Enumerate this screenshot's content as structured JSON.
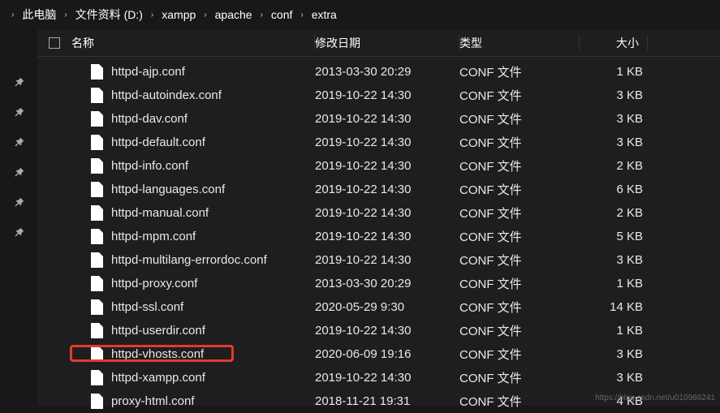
{
  "breadcrumb": [
    "此电脑",
    "文件资料 (D:)",
    "xampp",
    "apache",
    "conf",
    "extra"
  ],
  "columns": {
    "name": "名称",
    "date": "修改日期",
    "type": "类型",
    "size": "大小"
  },
  "files": [
    {
      "name": "httpd-ajp.conf",
      "date": "2013-03-30 20:29",
      "type": "CONF 文件",
      "size": "1 KB"
    },
    {
      "name": "httpd-autoindex.conf",
      "date": "2019-10-22 14:30",
      "type": "CONF 文件",
      "size": "3 KB"
    },
    {
      "name": "httpd-dav.conf",
      "date": "2019-10-22 14:30",
      "type": "CONF 文件",
      "size": "3 KB"
    },
    {
      "name": "httpd-default.conf",
      "date": "2019-10-22 14:30",
      "type": "CONF 文件",
      "size": "3 KB"
    },
    {
      "name": "httpd-info.conf",
      "date": "2019-10-22 14:30",
      "type": "CONF 文件",
      "size": "2 KB"
    },
    {
      "name": "httpd-languages.conf",
      "date": "2019-10-22 14:30",
      "type": "CONF 文件",
      "size": "6 KB"
    },
    {
      "name": "httpd-manual.conf",
      "date": "2019-10-22 14:30",
      "type": "CONF 文件",
      "size": "2 KB"
    },
    {
      "name": "httpd-mpm.conf",
      "date": "2019-10-22 14:30",
      "type": "CONF 文件",
      "size": "5 KB"
    },
    {
      "name": "httpd-multilang-errordoc.conf",
      "date": "2019-10-22 14:30",
      "type": "CONF 文件",
      "size": "3 KB"
    },
    {
      "name": "httpd-proxy.conf",
      "date": "2013-03-30 20:29",
      "type": "CONF 文件",
      "size": "1 KB"
    },
    {
      "name": "httpd-ssl.conf",
      "date": "2020-05-29 9:30",
      "type": "CONF 文件",
      "size": "14 KB"
    },
    {
      "name": "httpd-userdir.conf",
      "date": "2019-10-22 14:30",
      "type": "CONF 文件",
      "size": "1 KB"
    },
    {
      "name": "httpd-vhosts.conf",
      "date": "2020-06-09 19:16",
      "type": "CONF 文件",
      "size": "3 KB"
    },
    {
      "name": "httpd-xampp.conf",
      "date": "2019-10-22 14:30",
      "type": "CONF 文件",
      "size": "3 KB"
    },
    {
      "name": "proxy-html.conf",
      "date": "2018-11-21 19:31",
      "type": "CONF 文件",
      "size": "4 KB"
    }
  ],
  "highlight_index": 12,
  "watermark": "https://blog.csdn.net/u010986241"
}
